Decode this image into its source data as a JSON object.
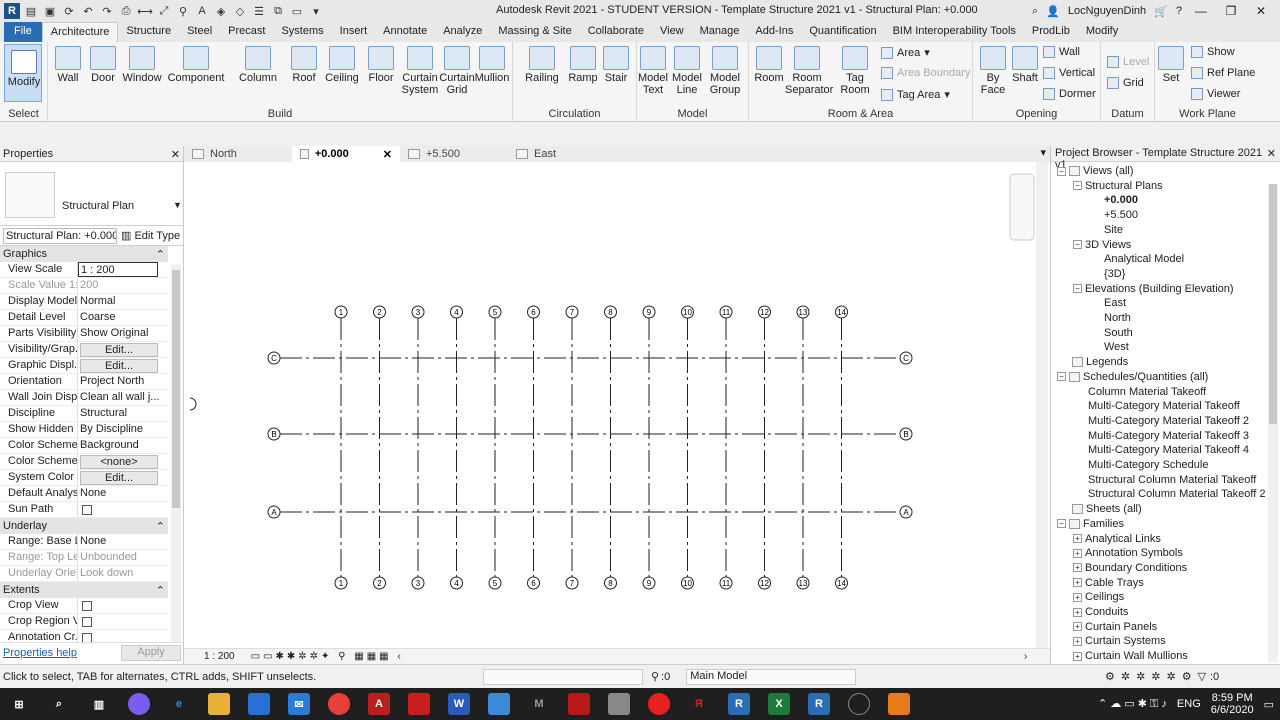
{
  "window": {
    "title": "Autodesk Revit 2021 - STUDENT VERSION - Template Structure 2021 v1 - Structural Plan: +0.000",
    "user": "LocNguyenDinh",
    "app_logo": "R"
  },
  "ribbon_tabs": [
    "File",
    "Architecture",
    "Structure",
    "Steel",
    "Precast",
    "Systems",
    "Insert",
    "Annotate",
    "Analyze",
    "Massing & Site",
    "Collaborate",
    "View",
    "Manage",
    "Add-Ins",
    "Quantification",
    "BIM Interoperability Tools",
    "ProdLib",
    "Modify"
  ],
  "ribbon": {
    "select": {
      "modify": "Modify",
      "label": "Select"
    },
    "build": {
      "label": "Build",
      "wall": "Wall",
      "door": "Door",
      "window": "Window",
      "component": "Component",
      "column": "Column",
      "roof": "Roof",
      "ceiling": "Ceiling",
      "floor": "Floor",
      "curtain_system": "Curtain System",
      "curtain_grid": "Curtain Grid",
      "mullion": "Mullion"
    },
    "circulation": {
      "label": "Circulation",
      "railing": "Railing",
      "ramp": "Ramp",
      "stair": "Stair"
    },
    "model": {
      "label": "Model",
      "model_text": "Model Text",
      "model_line": "Model Line",
      "model_group": "Model Group"
    },
    "room_area": {
      "label": "Room & Area",
      "room": "Room",
      "room_separator": "Room Separator",
      "tag_room": "Tag Room",
      "area": "Area",
      "area_boundary": "Area Boundary",
      "tag_area": "Tag Area"
    },
    "opening": {
      "label": "Opening",
      "by_face": "By Face",
      "shaft": "Shaft",
      "wall": "Wall",
      "vertical": "Vertical",
      "dormer": "Dormer"
    },
    "datum": {
      "label": "Datum",
      "level": "Level",
      "grid": "Grid"
    },
    "work_plane": {
      "label": "Work Plane",
      "set": "Set",
      "show": "Show",
      "ref_plane": "Ref Plane",
      "viewer": "Viewer"
    }
  },
  "properties": {
    "title": "Properties",
    "type_name": "Structural Plan",
    "filter": "Structural Plan: +0.000",
    "edit_type": "Edit Type",
    "sections": [
      {
        "name": "Graphics",
        "rows": [
          {
            "n": "View Scale",
            "v": "1 : 200"
          },
          {
            "n": "Scale Value    1:",
            "v": "200"
          },
          {
            "n": "Display Model",
            "v": "Normal"
          },
          {
            "n": "Detail Level",
            "v": "Coarse"
          },
          {
            "n": "Parts Visibility",
            "v": "Show Original"
          },
          {
            "n": "Visibility/Grap...",
            "v": "Edit..."
          },
          {
            "n": "Graphic Displ...",
            "v": "Edit..."
          },
          {
            "n": "Orientation",
            "v": "Project North"
          },
          {
            "n": "Wall Join Disp...",
            "v": "Clean all wall j..."
          },
          {
            "n": "Discipline",
            "v": "Structural"
          },
          {
            "n": "Show Hidden ...",
            "v": "By Discipline"
          },
          {
            "n": "Color Scheme ...",
            "v": "Background"
          },
          {
            "n": "Color Scheme",
            "v": "<none>"
          },
          {
            "n": "System Color ...",
            "v": "Edit..."
          },
          {
            "n": "Default Analys...",
            "v": "None"
          },
          {
            "n": "Sun Path",
            "v": ""
          }
        ]
      },
      {
        "name": "Underlay",
        "rows": [
          {
            "n": "Range: Base L...",
            "v": "None"
          },
          {
            "n": "Range: Top Le...",
            "v": "Unbounded"
          },
          {
            "n": "Underlay Orie...",
            "v": "Look down"
          }
        ]
      },
      {
        "name": "Extents",
        "rows": [
          {
            "n": "Crop View",
            "v": ""
          },
          {
            "n": "Crop Region V...",
            "v": ""
          },
          {
            "n": "Annotation Cr...",
            "v": ""
          }
        ]
      }
    ],
    "help": "Properties help",
    "apply": "Apply"
  },
  "view_tabs": [
    "North",
    "+0.000",
    "+5.500",
    "East"
  ],
  "grid": {
    "columns": [
      "1",
      "2",
      "3",
      "4",
      "5",
      "6",
      "7",
      "8",
      "9",
      "10",
      "11",
      "12",
      "13",
      "14"
    ],
    "rows": [
      "C",
      "B",
      "A"
    ]
  },
  "view_scale": "1 : 200",
  "project_browser": {
    "title": "Project Browser - Template Structure 2021 v1",
    "nodes": [
      {
        "t": "Views (all)",
        "lvl": 0,
        "exp": "-",
        "icon": true
      },
      {
        "t": "Structural Plans",
        "lvl": 1,
        "exp": "-"
      },
      {
        "t": "+0.000",
        "lvl": 2,
        "bold": true
      },
      {
        "t": "+5.500",
        "lvl": 2
      },
      {
        "t": "Site",
        "lvl": 2
      },
      {
        "t": "3D Views",
        "lvl": 1,
        "exp": "-"
      },
      {
        "t": "Analytical Model",
        "lvl": 2
      },
      {
        "t": "{3D}",
        "lvl": 2
      },
      {
        "t": "Elevations (Building Elevation)",
        "lvl": 1,
        "exp": "-"
      },
      {
        "t": "East",
        "lvl": 2
      },
      {
        "t": "North",
        "lvl": 2
      },
      {
        "t": "South",
        "lvl": 2
      },
      {
        "t": "West",
        "lvl": 2
      },
      {
        "t": "Legends",
        "lvl": 0,
        "icon": true
      },
      {
        "t": "Schedules/Quantities (all)",
        "lvl": 0,
        "exp": "-",
        "icon": true
      },
      {
        "t": "Column Material Takeoff",
        "lvl": 1
      },
      {
        "t": "Multi-Category Material Takeoff",
        "lvl": 1
      },
      {
        "t": "Multi-Category Material Takeoff 2",
        "lvl": 1
      },
      {
        "t": "Multi-Category Material Takeoff 3",
        "lvl": 1
      },
      {
        "t": "Multi-Category Material Takeoff 4",
        "lvl": 1
      },
      {
        "t": "Multi-Category Schedule",
        "lvl": 1
      },
      {
        "t": "Structural Column Material Takeoff",
        "lvl": 1
      },
      {
        "t": "Structural Column Material Takeoff 2",
        "lvl": 1
      },
      {
        "t": "Sheets (all)",
        "lvl": 0,
        "icon": true
      },
      {
        "t": "Families",
        "lvl": 0,
        "exp": "-",
        "icon": true
      },
      {
        "t": "Analytical Links",
        "lvl": 1,
        "exp": "+"
      },
      {
        "t": "Annotation Symbols",
        "lvl": 1,
        "exp": "+"
      },
      {
        "t": "Boundary Conditions",
        "lvl": 1,
        "exp": "+"
      },
      {
        "t": "Cable Trays",
        "lvl": 1,
        "exp": "+"
      },
      {
        "t": "Ceilings",
        "lvl": 1,
        "exp": "+"
      },
      {
        "t": "Conduits",
        "lvl": 1,
        "exp": "+"
      },
      {
        "t": "Curtain Panels",
        "lvl": 1,
        "exp": "+"
      },
      {
        "t": "Curtain Systems",
        "lvl": 1,
        "exp": "+"
      },
      {
        "t": "Curtain Wall Mullions",
        "lvl": 1,
        "exp": "+"
      }
    ]
  },
  "status": {
    "message": "Click to select, TAB for alternates, CTRL adds, SHIFT unselects.",
    "zero": ":0",
    "model": "Main Model",
    "filter_count": ":0"
  },
  "taskbar": {
    "time": "8:59 PM",
    "date": "6/6/2020",
    "lang": "ENG"
  }
}
